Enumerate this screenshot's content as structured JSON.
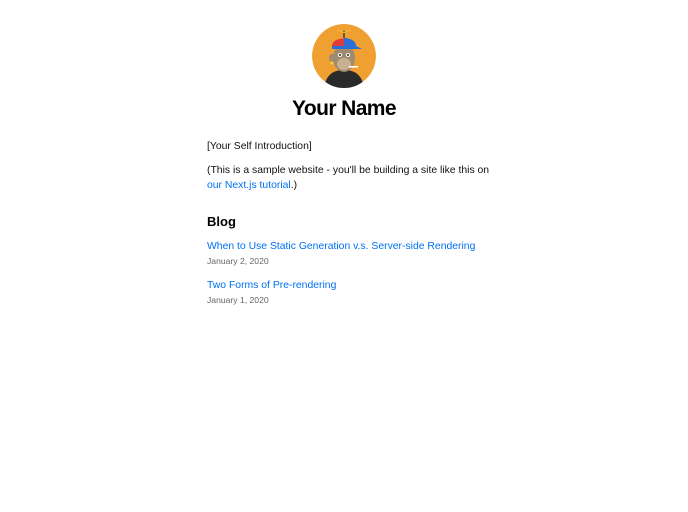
{
  "header": {
    "avatar_icon": "profile-avatar-ape-icon",
    "name": "Your Name"
  },
  "intro": {
    "self_intro": "[Your Self Introduction]",
    "sample_text_before": "(This is a sample website - you'll be building a site like this on ",
    "tutorial_link": "our Next.js tutorial",
    "sample_text_after": ".)"
  },
  "blog": {
    "heading": "Blog",
    "posts": [
      {
        "title": "When to Use Static Generation v.s. Server-side Rendering",
        "date": "January 2, 2020"
      },
      {
        "title": "Two Forms of Pre-rendering",
        "date": "January 1, 2020"
      }
    ]
  },
  "colors": {
    "link": "#0070f3",
    "date": "#666666",
    "avatar_bg": "#f0a030"
  }
}
